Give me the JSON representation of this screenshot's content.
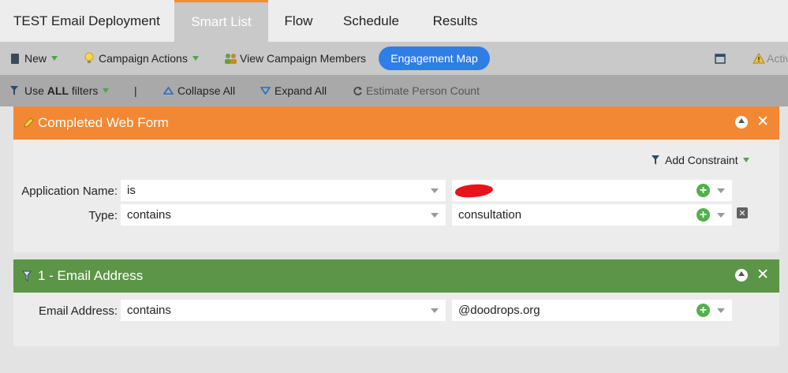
{
  "tabs": [
    {
      "label": "TEST Email Deployment"
    },
    {
      "label": "Smart List"
    },
    {
      "label": "Flow"
    },
    {
      "label": "Schedule"
    },
    {
      "label": "Results"
    }
  ],
  "toolbar": {
    "new_label": "New",
    "campaign_actions_label": "Campaign Actions",
    "view_members_label": "View Campaign Members",
    "engagement_map_label": "Engagement Map",
    "activate_label": "Activ"
  },
  "filterbar": {
    "use_filters_prefix": "Use",
    "use_filters_bold": "ALL",
    "use_filters_suffix": "filters",
    "separator": "|",
    "collapse_label": "Collapse All",
    "expand_label": "Expand All",
    "estimate_label": "Estimate Person Count"
  },
  "filter1": {
    "title": "Completed Web Form",
    "add_constraint_label": "Add Constraint",
    "rows": [
      {
        "label": "Application Name:",
        "operator": "is",
        "value": ""
      },
      {
        "label": "Type:",
        "operator": "contains",
        "value": "consultation"
      }
    ]
  },
  "filter2": {
    "title": "1 - Email Address",
    "rows": [
      {
        "label": "Email Address:",
        "operator": "contains",
        "value": "@doodrops.org"
      }
    ]
  },
  "colors": {
    "orange_header": "#f38834",
    "green_header": "#5d9548",
    "engagement_blue": "#2e7ee6"
  }
}
